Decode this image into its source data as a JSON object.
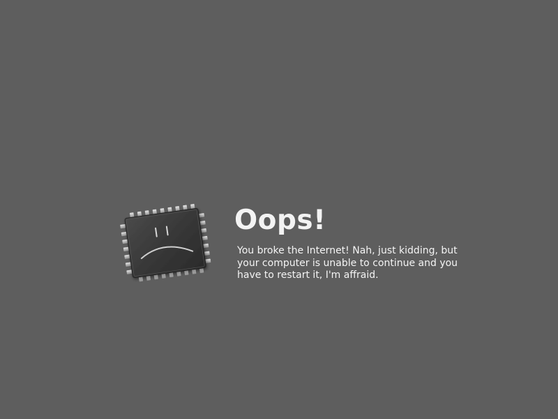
{
  "error": {
    "title": "Oops!",
    "message": "You broke the Internet! Nah, just kidding, but your computer is unable to continue and you have to restart it, I'm affraid."
  },
  "icon": "sad-chip-icon",
  "colors": {
    "background": "#5e5e5e",
    "text": "#f3f3f3",
    "chip_body": "#3a3a3a"
  }
}
